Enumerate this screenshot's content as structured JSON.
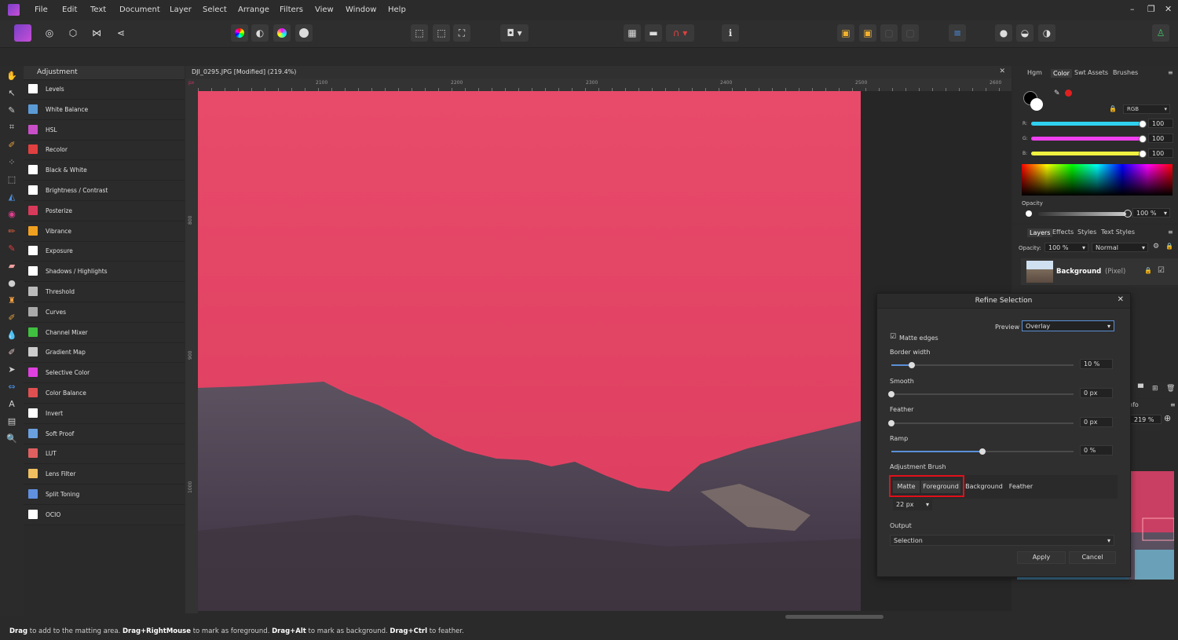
{
  "menu": [
    "File",
    "Edit",
    "Text",
    "Document",
    "Layer",
    "Select",
    "Arrange",
    "Filters",
    "View",
    "Window",
    "Help"
  ],
  "window_controls": [
    "–",
    "❐",
    "✕"
  ],
  "adjustment_panel": {
    "title": "Adjustment",
    "items": [
      {
        "label": "Levels",
        "icon": "levels-icon",
        "color": "#ffffff"
      },
      {
        "label": "White Balance",
        "icon": "white-balance-icon",
        "color": "#5b9bd5"
      },
      {
        "label": "HSL",
        "icon": "hsl-icon",
        "color": "#c94fc9"
      },
      {
        "label": "Recolor",
        "icon": "recolor-icon",
        "color": "#e04040"
      },
      {
        "label": "Black & White",
        "icon": "black-white-icon",
        "color": "#ffffff"
      },
      {
        "label": "Brightness / Contrast",
        "icon": "brightness-contrast-icon",
        "color": "#ffffff"
      },
      {
        "label": "Posterize",
        "icon": "posterize-icon",
        "color": "#d83a5a"
      },
      {
        "label": "Vibrance",
        "icon": "vibrance-icon",
        "color": "#f0a020"
      },
      {
        "label": "Exposure",
        "icon": "exposure-icon",
        "color": "#ffffff"
      },
      {
        "label": "Shadows / Highlights",
        "icon": "shadows-highlights-icon",
        "color": "#ffffff"
      },
      {
        "label": "Threshold",
        "icon": "threshold-icon",
        "color": "#bbbbbb"
      },
      {
        "label": "Curves",
        "icon": "curves-icon",
        "color": "#aaaaaa"
      },
      {
        "label": "Channel Mixer",
        "icon": "channel-mixer-icon",
        "color": "#40c040"
      },
      {
        "label": "Gradient Map",
        "icon": "gradient-map-icon",
        "color": "#cccccc"
      },
      {
        "label": "Selective Color",
        "icon": "selective-color-icon",
        "color": "#e040e0"
      },
      {
        "label": "Color Balance",
        "icon": "color-balance-icon",
        "color": "#e05050"
      },
      {
        "label": "Invert",
        "icon": "invert-icon",
        "color": "#ffffff"
      },
      {
        "label": "Soft Proof",
        "icon": "soft-proof-icon",
        "color": "#6aa0e0"
      },
      {
        "label": "LUT",
        "icon": "lut-icon",
        "color": "#e06060"
      },
      {
        "label": "Lens Filter",
        "icon": "lens-filter-icon",
        "color": "#f0c060"
      },
      {
        "label": "Split Toning",
        "icon": "split-toning-icon",
        "color": "#6090e0"
      },
      {
        "label": "OCIO",
        "icon": "ocio-icon",
        "color": "#ffffff"
      }
    ]
  },
  "document": {
    "title": "DJI_0295.JPG [Modified] (219.4%)",
    "ruler_unit": "px",
    "ruler_top": [
      "2100",
      "2200",
      "2300",
      "2400",
      "2500",
      "2600"
    ],
    "ruler_left": [
      "800",
      "900",
      "1000"
    ]
  },
  "color_panel": {
    "tabs": [
      "Hgm",
      "Color",
      "Swt",
      "Assets",
      "Brushes"
    ],
    "mode": "RGB",
    "channels": [
      {
        "label": "R:",
        "value": "100",
        "color": "#30d0f0"
      },
      {
        "label": "G:",
        "value": "100",
        "color": "#f040f0"
      },
      {
        "label": "B:",
        "value": "100",
        "color": "#f0f040"
      }
    ],
    "opacity_label": "Opacity",
    "opacity_value": "100 %"
  },
  "layers_panel": {
    "tabs": [
      "Layers",
      "Effects",
      "Styles",
      "Text Styles"
    ],
    "opacity_label": "Opacity:",
    "opacity_value": "100 %",
    "blend_mode": "Normal",
    "layer_name": "Background",
    "layer_type": "(Pixel)"
  },
  "info_panel": {
    "tab": "nfo",
    "zoom": "219 %"
  },
  "refine_dialog": {
    "title": "Refine Selection",
    "preview_label": "Preview",
    "preview_value": "Overlay",
    "matte_edges_label": "Matte edges",
    "border_width": {
      "label": "Border width",
      "value": "10 %",
      "level": 0.11
    },
    "smooth": {
      "label": "Smooth",
      "value": "0 px",
      "level": 0
    },
    "feather": {
      "label": "Feather",
      "value": "0 px",
      "level": 0
    },
    "ramp": {
      "label": "Ramp",
      "value": "0 %",
      "level": 0.5
    },
    "adjustment_brush_label": "Adjustment Brush",
    "brush_modes": [
      "Matte",
      "Foreground",
      "Background",
      "Feather"
    ],
    "brush_size": "22 px",
    "output_label": "Output",
    "output_value": "Selection",
    "apply_label": "Apply",
    "cancel_label": "Cancel"
  },
  "status": {
    "parts": [
      {
        "bold": "Drag",
        "text": " to add to the matting area. "
      },
      {
        "bold": "Drag+RightMouse",
        "text": " to mark as foreground. "
      },
      {
        "bold": "Drag+Alt",
        "text": " to mark as background. "
      },
      {
        "bold": "Drag+Ctrl",
        "text": " to feather."
      }
    ]
  }
}
